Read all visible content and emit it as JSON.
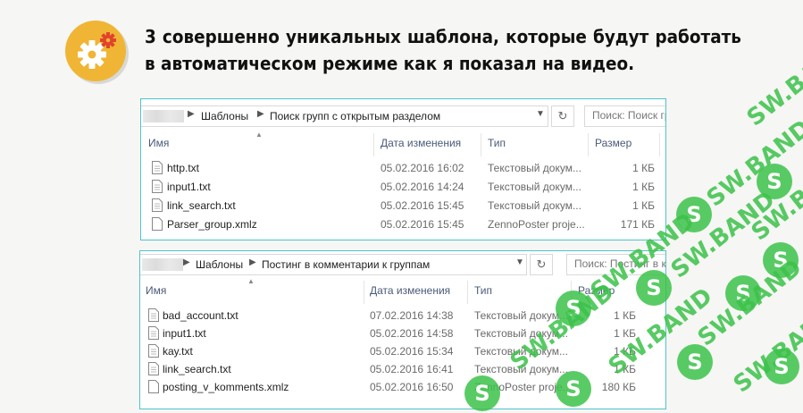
{
  "headline": "3 совершенно уникальных шаблона, которые будут работать в автоматическом режиме как я показал на видео.",
  "watermark": {
    "brand": "SW.BAND",
    "logo_letter": "S",
    "color": "#3cc24a"
  },
  "windows": [
    {
      "breadcrumb": [
        "Шаблоны",
        "Поиск групп с открытым разделом"
      ],
      "search_placeholder": "Поиск: Поиск гр",
      "columns": [
        "Имя",
        "Дата изменения",
        "Тип",
        "Размер"
      ],
      "files": [
        {
          "name": "http.txt",
          "date": "05.02.2016 16:02",
          "type": "Текстовый докум...",
          "size": "1 КБ"
        },
        {
          "name": "input1.txt",
          "date": "05.02.2016 14:24",
          "type": "Текстовый докум...",
          "size": "1 КБ"
        },
        {
          "name": "link_search.txt",
          "date": "05.02.2016 15:45",
          "type": "Текстовый докум...",
          "size": "1 КБ"
        },
        {
          "name": "Parser_group.xmlz",
          "date": "05.02.2016 15:45",
          "type": "ZennoPoster proje...",
          "size": "171 КБ"
        }
      ]
    },
    {
      "breadcrumb": [
        "Шаблоны",
        "Постинг в комментарии к группам"
      ],
      "search_placeholder": "Поиск: Постинг в к",
      "columns": [
        "Имя",
        "Дата изменения",
        "Тип",
        "Размер"
      ],
      "files": [
        {
          "name": "bad_account.txt",
          "date": "07.02.2016 14:38",
          "type": "Текстовый докум...",
          "size": "1 КБ"
        },
        {
          "name": "input1.txt",
          "date": "05.02.2016 14:58",
          "type": "Текстовый докум...",
          "size": "1 КБ"
        },
        {
          "name": "kay.txt",
          "date": "05.02.2016 15:34",
          "type": "Текстовый докум...",
          "size": "1 КБ"
        },
        {
          "name": "link_search.txt",
          "date": "05.02.2016 16:41",
          "type": "Текстовый докум...",
          "size": "1 КБ"
        },
        {
          "name": "posting_v_komments.xmlz",
          "date": "05.02.2016 16:50",
          "type": "ZennoPoster proje...",
          "size": "180 КБ"
        }
      ]
    }
  ]
}
